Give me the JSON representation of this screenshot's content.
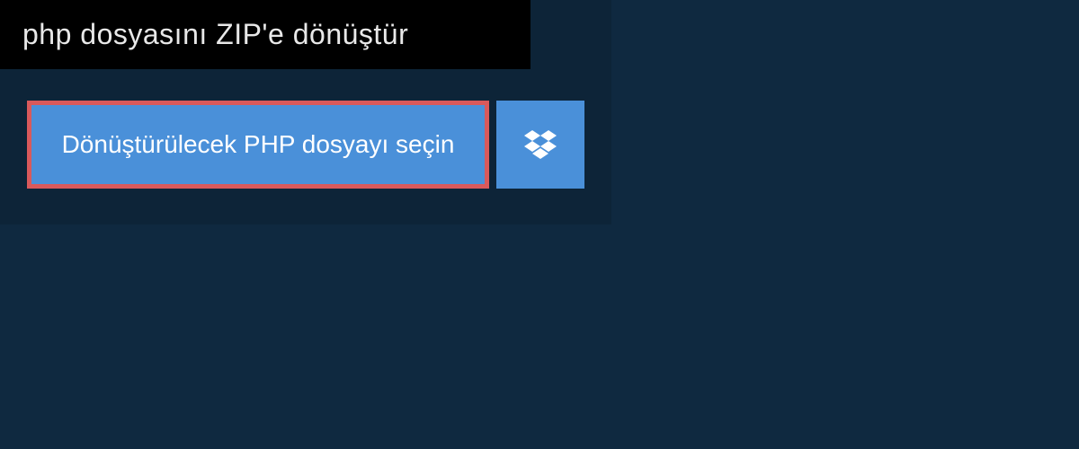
{
  "header": {
    "title": "php dosyasını ZIP'e dönüştür"
  },
  "upload": {
    "select_file_label": "Dönüştürülecek PHP dosyayı seçin"
  },
  "colors": {
    "page_bg": "#0f2940",
    "panel_bg": "#0d2438",
    "header_bg": "#000000",
    "button_bg": "#4a90d9",
    "button_border": "#d9595b",
    "text_light": "#ffffff"
  }
}
